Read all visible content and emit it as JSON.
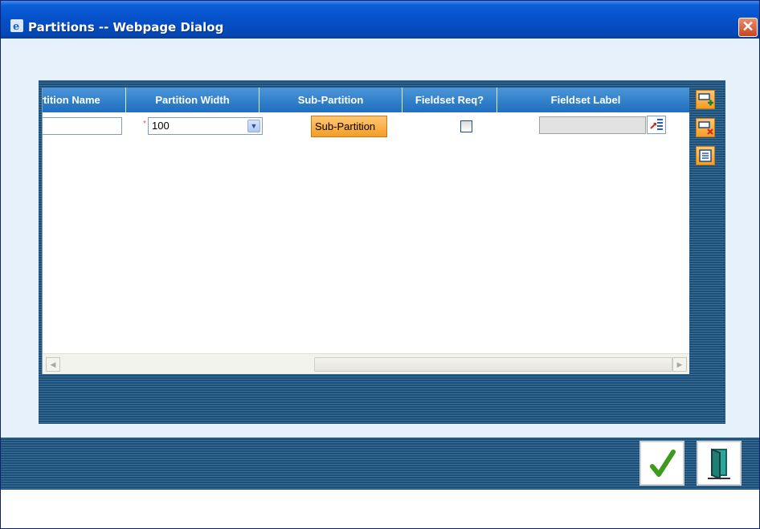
{
  "window": {
    "title": "Partitions -- Webpage Dialog",
    "close_glyph": "✕",
    "app_icon": "ie-icon"
  },
  "grid": {
    "columns": [
      {
        "label": "Partition Name"
      },
      {
        "label": "Partition Width"
      },
      {
        "label": "Sub-Partition"
      },
      {
        "label": "Fieldset Req?"
      },
      {
        "label": "Fieldset Label"
      }
    ],
    "rows": [
      {
        "partition_name": "",
        "required_mark": "*",
        "partition_width": "100",
        "sub_partition_button": "Sub-Partition",
        "fieldset_required": false,
        "fieldset_label": ""
      }
    ]
  },
  "side_actions": [
    {
      "name": "add-row-icon"
    },
    {
      "name": "delete-row-icon"
    },
    {
      "name": "list-view-icon"
    }
  ],
  "footer": {
    "ok_icon": "checkmark-icon",
    "exit_icon": "exit-door-icon"
  },
  "colors": {
    "titlebar": "#0550c8",
    "header": "#1e6fbf",
    "frame": "#1c4f7a",
    "accent_button": "#f59d26",
    "background": "#e6f1fb"
  }
}
